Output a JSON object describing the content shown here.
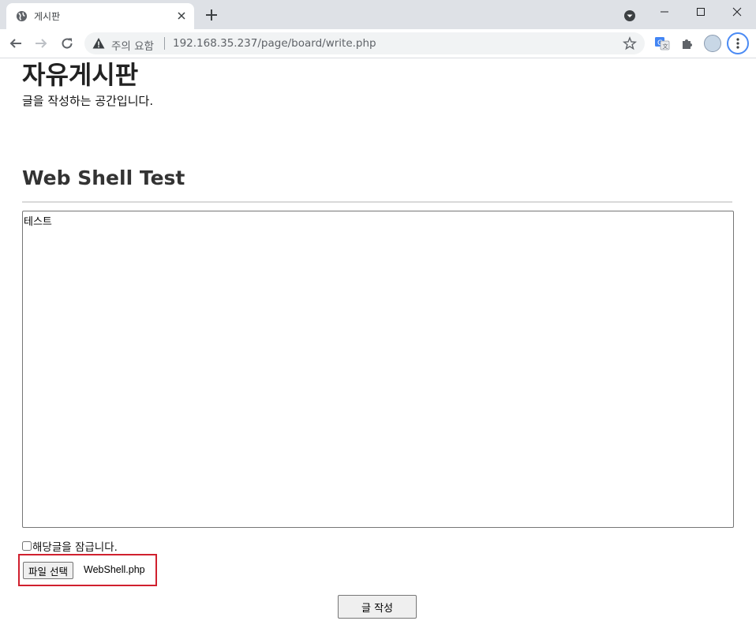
{
  "browser": {
    "tab_title": "게시판",
    "security_label": "주의 요함",
    "url": "192.168.35.237/page/board/write.php"
  },
  "page": {
    "heading": "자유게시판",
    "subheading": "글을 작성하는 공간입니다."
  },
  "post": {
    "title": "Web Shell Test",
    "content": "테스트",
    "lock_label": "해당글을 잠급니다.",
    "lock_checked": false,
    "file_button_label": "파일 선택",
    "file_name": "WebShell.php",
    "submit_label": "글 작성"
  },
  "colors": {
    "highlight_border": "#d0202e",
    "menu_focus_ring": "#4a8af4"
  },
  "icons": [
    "globe-icon",
    "close-icon",
    "plus-icon",
    "profile-dropdown-icon",
    "minimize-icon",
    "maximize-icon",
    "window-close-icon",
    "back-arrow-icon",
    "forward-arrow-icon",
    "reload-icon",
    "warning-icon",
    "star-icon",
    "translate-icon",
    "puzzle-icon",
    "avatar",
    "kebab-menu-icon"
  ]
}
